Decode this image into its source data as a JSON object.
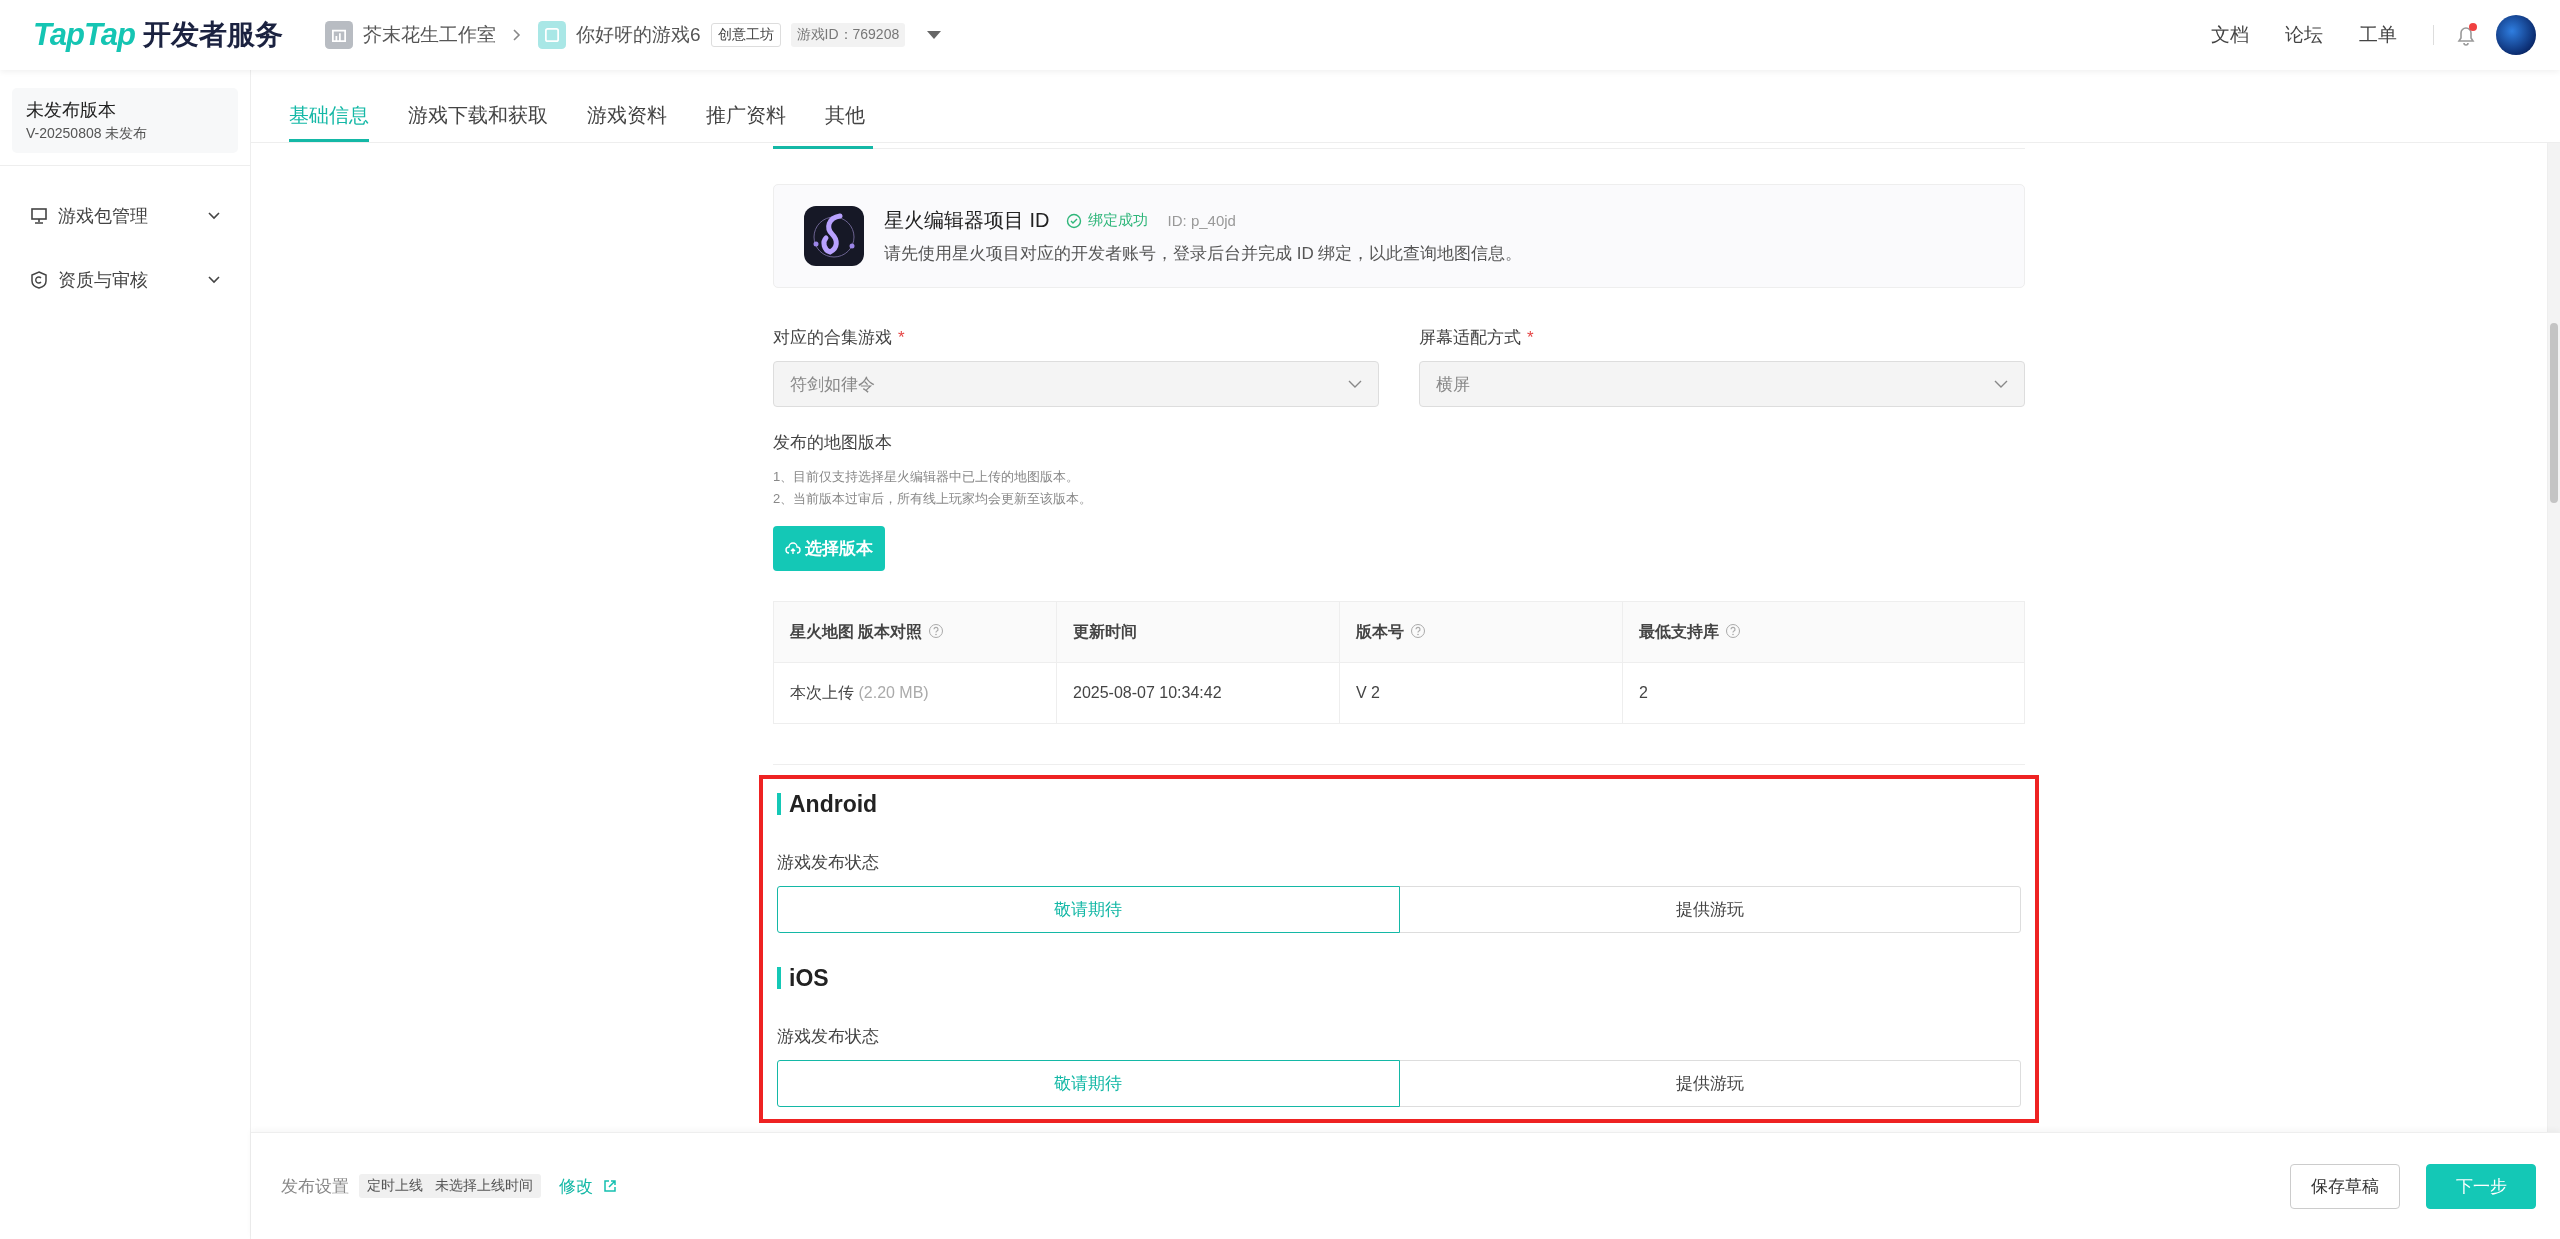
{
  "header": {
    "logo_brand": "TapTap",
    "logo_suffix": "开发者服务",
    "studio": "芥末花生工作室",
    "game": "你好呀的游戏6",
    "game_tag": "创意工坊",
    "game_id": "游戏ID：769208",
    "links": [
      "文档",
      "论坛",
      "工单"
    ],
    "has_notification": true
  },
  "sidebar": {
    "version_title": "未发布版本",
    "version_sub": "V-20250808 未发布",
    "items": [
      {
        "label": "游戏包管理",
        "kind": "package",
        "expanded": false
      },
      {
        "label": "资质与审核",
        "kind": "license",
        "expanded": false
      }
    ]
  },
  "tabs": [
    {
      "label": "基础信息",
      "selected": true
    },
    {
      "label": "游戏下载和获取",
      "selected": false
    },
    {
      "label": "游戏资料",
      "selected": false
    },
    {
      "label": "推广资料",
      "selected": false
    },
    {
      "label": "其他",
      "selected": false
    }
  ],
  "editor_card": {
    "title": "星火编辑器项目 ID",
    "status": "绑定成功",
    "id": "ID: p_40jd",
    "description": "请先使用星火项目对应的开发者账号，登录后台并完成 ID 绑定，以此查询地图信息。"
  },
  "selects": [
    {
      "label": "对应的合集游戏",
      "required_mark": "*",
      "value": "符剑如律令"
    },
    {
      "label": "屏幕适配方式",
      "required_mark": "*",
      "value": "横屏"
    }
  ],
  "map_version": {
    "label": "发布的地图版本",
    "notes": [
      "1、目前仅支持选择星火编辑器中已上传的地图版本。",
      "2、当前版本过审后，所有线上玩家均会更新至该版本。"
    ],
    "button": "选择版本"
  },
  "table": {
    "columns": [
      {
        "label": "星火地图 版本对照",
        "help": true
      },
      {
        "label": "更新时间",
        "help": false
      },
      {
        "label": "版本号",
        "help": true
      },
      {
        "label": "最低支持库",
        "help": true
      }
    ],
    "rows": [
      {
        "cells": [
          "本次上传",
          "2025-08-07 10:34:42",
          "V 2",
          "2"
        ],
        "size": "(2.20 MB)"
      }
    ]
  },
  "platform_section": {
    "highlighted": true,
    "platforms": [
      {
        "name": "Android",
        "field_label": "游戏发布状态",
        "options": [
          {
            "label": "敬请期待",
            "selected": true
          },
          {
            "label": "提供游玩",
            "selected": false
          }
        ]
      },
      {
        "name": "iOS",
        "field_label": "游戏发布状态",
        "options": [
          {
            "label": "敬请期待",
            "selected": true
          },
          {
            "label": "提供游玩",
            "selected": false
          }
        ]
      }
    ]
  },
  "footer": {
    "label": "发布设置",
    "schedule_type": "定时上线",
    "schedule_value": "未选择上线时间",
    "edit_link": "修改",
    "buttons": [
      {
        "label": "保存草稿",
        "kind": "secondary"
      },
      {
        "label": "下一步",
        "kind": "primary"
      }
    ]
  }
}
